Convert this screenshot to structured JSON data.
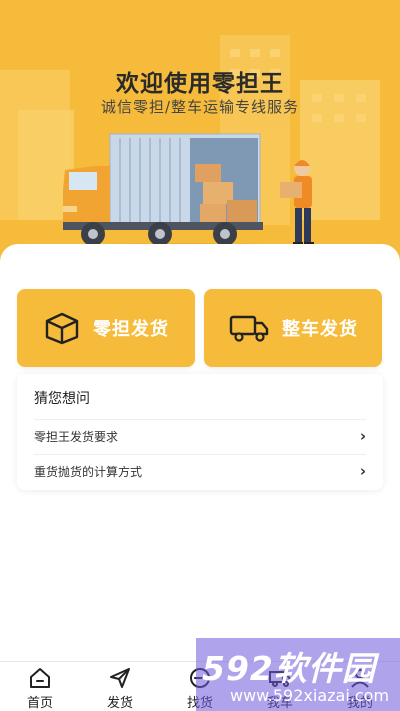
{
  "hero": {
    "title": "欢迎使用零担王",
    "subtitle": "诚信零担/整车运输专线服务"
  },
  "actions": [
    {
      "label": "零担发货",
      "icon": "box-icon"
    },
    {
      "label": "整车发货",
      "icon": "truck-icon"
    }
  ],
  "faq": {
    "title": "猜您想问",
    "items": [
      {
        "label": "零担王发货要求"
      },
      {
        "label": "重货抛货的计算方式"
      }
    ]
  },
  "tabbar": {
    "items": [
      {
        "label": "首页",
        "icon": "home-icon"
      },
      {
        "label": "发货",
        "icon": "send-icon"
      },
      {
        "label": "找货",
        "icon": "search-icon"
      },
      {
        "label": "我车",
        "icon": "truck-icon"
      },
      {
        "label": "我的",
        "icon": "user-icon"
      }
    ]
  },
  "watermark": {
    "brand": "592软件园",
    "url": "www.592xiazai.com"
  },
  "colors": {
    "accent": "#f6bb3b",
    "watermark": "#6e5adc"
  }
}
